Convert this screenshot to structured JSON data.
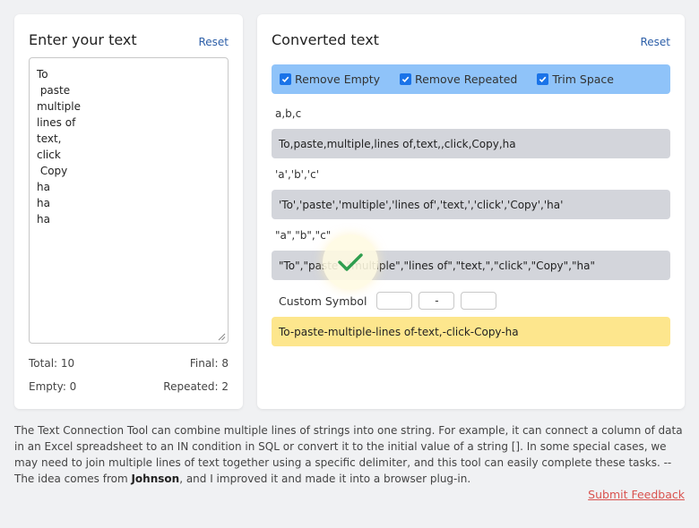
{
  "input_panel": {
    "title": "Enter your text",
    "reset_label": "Reset",
    "lines": [
      "To",
      " paste",
      "multiple",
      "lines of",
      "text,",
      "click",
      " Copy",
      "ha",
      "ha",
      "ha"
    ],
    "stats": {
      "total": "Total: 10",
      "final": "Final: 8",
      "empty": "Empty: 0",
      "repeated": "Repeated: 2"
    }
  },
  "output_panel": {
    "title": "Converted text",
    "reset_label": "Reset",
    "options": [
      {
        "label": "Remove Empty",
        "checked": true
      },
      {
        "label": "Remove Repeated",
        "checked": true
      },
      {
        "label": "Trim Space",
        "checked": true
      }
    ],
    "formats": [
      {
        "label": "a,b,c",
        "result": "To,paste,multiple,lines of,text,,click,Copy,ha"
      },
      {
        "label": "'a','b','c'",
        "result": "'To','paste','multiple','lines of','text,','click','Copy','ha'"
      },
      {
        "label": "\"a\",\"b\",\"c\"",
        "result": "\"To\",\"paste\",\"multiple\",\"lines of\",\"text,\",\"click\",\"Copy\",\"ha\""
      }
    ],
    "custom": {
      "label": "Custom Symbol",
      "prefix": "",
      "delimiter": "-",
      "suffix": "",
      "result": "To-paste-multiple-lines of-text,-click-Copy-ha"
    }
  },
  "description": {
    "part1": "The Text Connection Tool can combine multiple lines of strings into one string. For example, it can connect a column of data in an Excel spreadsheet to an IN condition in SQL or convert it to the initial value of a string []. In some special cases, we may need to join multiple lines of text together using a specific delimiter, and this tool can easily complete these tasks. -- The idea comes from ",
    "author": "Johnson",
    "part2": ", and I improved it and made it into a browser plug-in."
  },
  "feedback_label": "Submit Feedback",
  "colors": {
    "options_bar": "#8fc3f9",
    "result_bg": "#d3d5db",
    "custom_result_bg": "#fde68d",
    "link": "#2d5fa8",
    "feedback": "#d9534f",
    "check": "#2e9e4f"
  },
  "icons": {
    "toast": "check-icon"
  }
}
